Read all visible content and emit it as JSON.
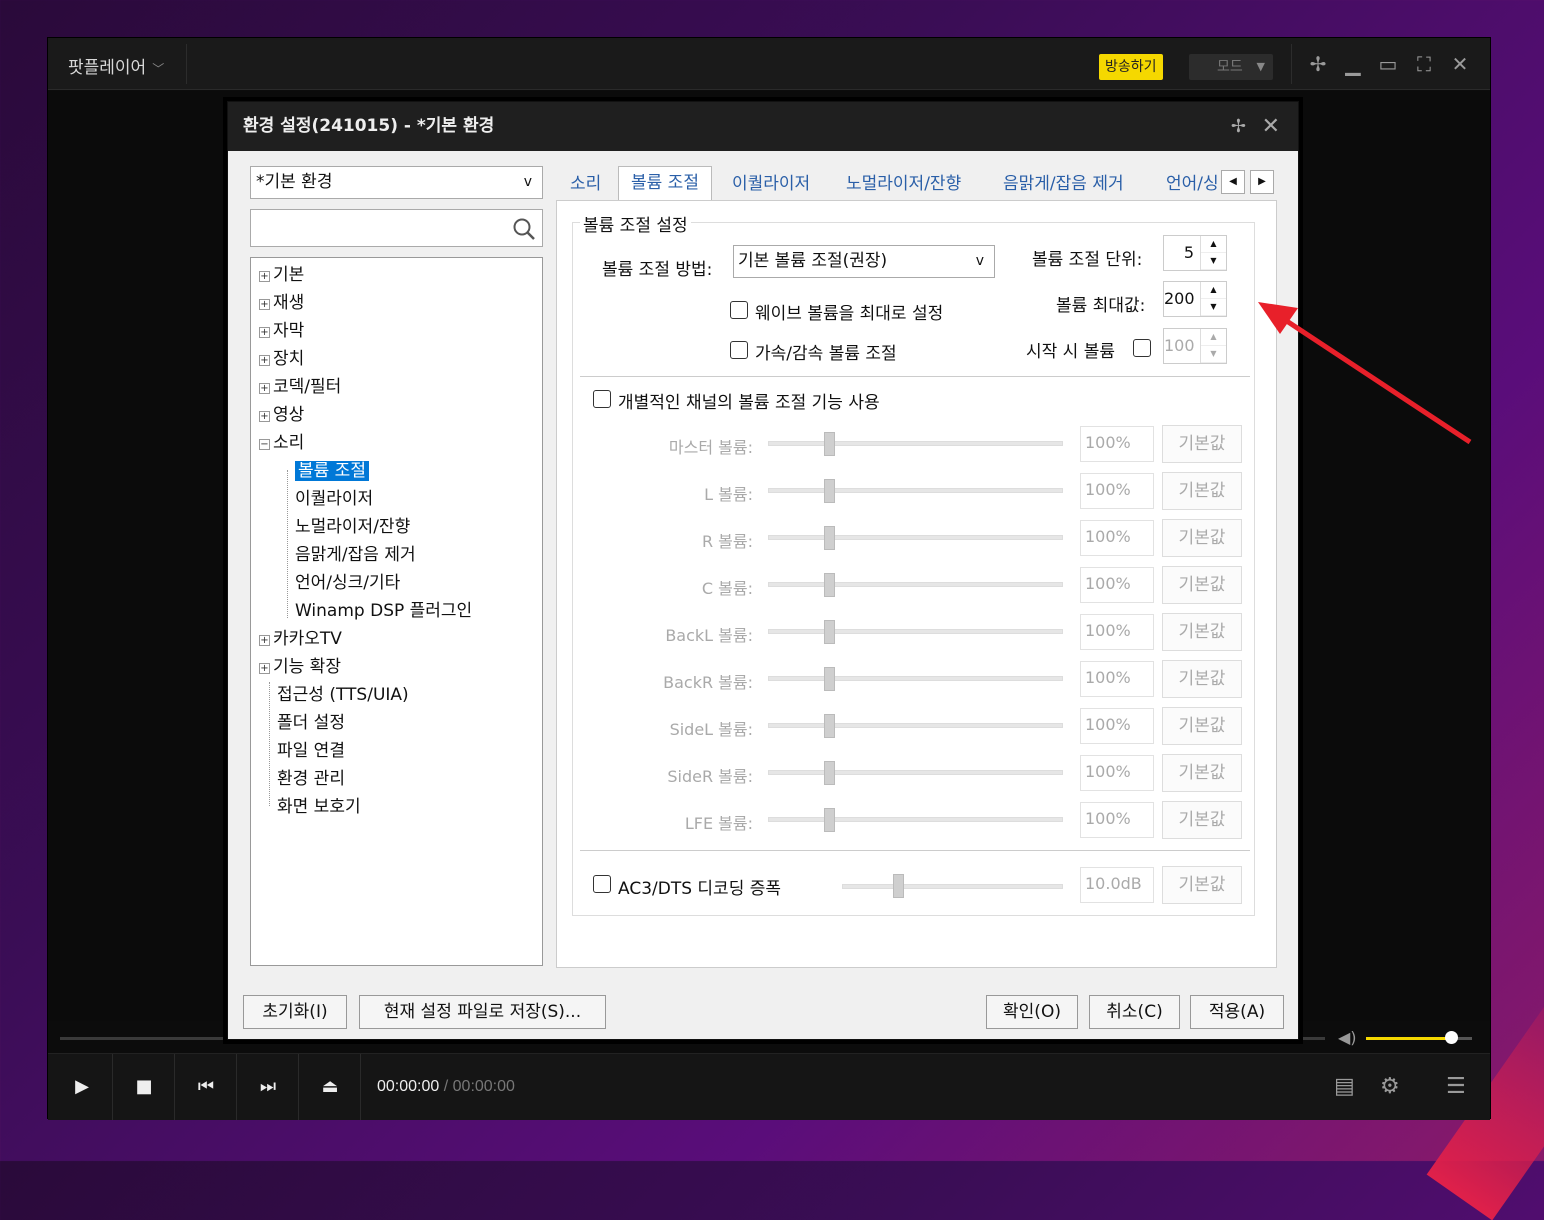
{
  "app": {
    "title": "팟플레이어",
    "broadcast_label": "방송하기",
    "mode_label": "모드",
    "time_current": "00:00:00",
    "time_separator": "/",
    "time_total": "00:00:00",
    "volume_level": 0.8
  },
  "dialog": {
    "title": "환경 설정(241015) - *기본 환경",
    "profile_value": "*기본 환경",
    "tree": [
      {
        "label": "기본",
        "expander": "+"
      },
      {
        "label": "재생",
        "expander": "+"
      },
      {
        "label": "자막",
        "expander": "+"
      },
      {
        "label": "장치",
        "expander": "+"
      },
      {
        "label": "코덱/필터",
        "expander": "+"
      },
      {
        "label": "영상",
        "expander": "+"
      },
      {
        "label": "소리",
        "expander": "−"
      },
      {
        "label": "볼륨 조절",
        "selected": true
      },
      {
        "label": "이퀄라이저"
      },
      {
        "label": "노멀라이저/잔향"
      },
      {
        "label": "음맑게/잡음 제거"
      },
      {
        "label": "언어/싱크/기타"
      },
      {
        "label": "Winamp DSP 플러그인"
      },
      {
        "label": "카카오TV",
        "expander": "+"
      },
      {
        "label": "기능 확장",
        "expander": "+"
      },
      {
        "label": "접근성 (TTS/UIA)"
      },
      {
        "label": "폴더 설정"
      },
      {
        "label": "파일 연결"
      },
      {
        "label": "환경 관리"
      },
      {
        "label": "화면 보호기"
      }
    ],
    "tabs": [
      "소리",
      "볼륨 조절",
      "이퀄라이저",
      "노멀라이저/잔향",
      "음맑게/잡음 제거",
      "언어/싱"
    ],
    "active_tab": "볼륨 조절",
    "group_title": "볼륨 조절 설정",
    "method_label": "볼륨 조절 방법:",
    "method_value": "기본 볼륨 조절(권장)",
    "step_label": "볼륨 조절 단위:",
    "step_value": "5",
    "max_label": "볼륨 최대값:",
    "max_value": "200",
    "start_label": "시작 시 볼륨",
    "start_value": "100",
    "wave_max_label": "웨이브 볼륨을 최대로 설정",
    "accel_label": "가속/감속 볼륨 조절",
    "per_channel_label": "개별적인 채널의 볼륨 조절 기능 사용",
    "channels": [
      {
        "label": "마스터 볼륨:",
        "value": "100%",
        "button": "기본값"
      },
      {
        "label": "L 볼륨:",
        "value": "100%",
        "button": "기본값"
      },
      {
        "label": "R 볼륨:",
        "value": "100%",
        "button": "기본값"
      },
      {
        "label": "C 볼륨:",
        "value": "100%",
        "button": "기본값"
      },
      {
        "label": "BackL 볼륨:",
        "value": "100%",
        "button": "기본값"
      },
      {
        "label": "BackR 볼륨:",
        "value": "100%",
        "button": "기본값"
      },
      {
        "label": "SideL 볼륨:",
        "value": "100%",
        "button": "기본값"
      },
      {
        "label": "SideR 볼륨:",
        "value": "100%",
        "button": "기본값"
      },
      {
        "label": "LFE 볼륨:",
        "value": "100%",
        "button": "기본값"
      }
    ],
    "ac3_label": "AC3/DTS 디코딩 증폭",
    "ac3_value": "10.0dB",
    "ac3_button": "기본값",
    "buttons": {
      "reset": "초기화(I)",
      "save": "현재 설정 파일로 저장(S)...",
      "ok": "확인(O)",
      "cancel": "취소(C)",
      "apply": "적용(A)"
    }
  },
  "colors": {
    "accent": "#f5d800",
    "selection": "#0078d7",
    "annotation_arrow": "#e8202a"
  }
}
